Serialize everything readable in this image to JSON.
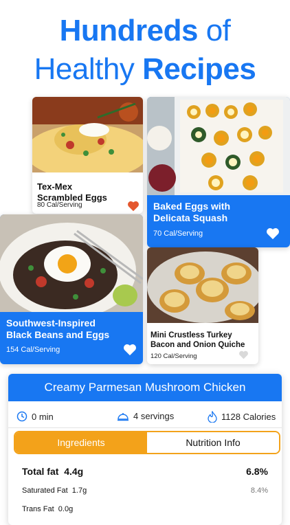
{
  "headline": {
    "line1_strong": "Hundreds",
    "line1_light": " of",
    "line2_light": "Healthy ",
    "line2_strong": "Recipes"
  },
  "cards": [
    {
      "title_line1": "Tex-Mex",
      "title_line2": "Scrambled Eggs",
      "calories": "80 Cal/Serving",
      "favorited": true
    },
    {
      "title_line1": "Baked Eggs with",
      "title_line2": "Delicata Squash",
      "calories": "70 Cal/Serving",
      "favorited": false
    },
    {
      "title_line1": "Southwest-Inspired",
      "title_line2": "Black Beans and Eggs",
      "calories": "154 Cal/Serving",
      "favorited": false
    },
    {
      "title_line1": "Mini Crustless Turkey",
      "title_line2": "Bacon and Onion Quiche",
      "calories": "120 Cal/Serving",
      "favorited": false
    }
  ],
  "detail": {
    "title": "Creamy Parmesan Mushroom Chicken",
    "time": "0 min",
    "servings": "4 servings",
    "calories": "1128 Calories",
    "tabs": {
      "ingredients": "Ingredients",
      "nutrition": "Nutrition Info"
    },
    "nutrition": [
      {
        "label": "Total fat",
        "value": "4.4g",
        "percent": "6.8%"
      },
      {
        "label": "Saturated Fat",
        "value": "1.7g",
        "percent": "8.4%"
      },
      {
        "label": "Trans Fat",
        "value": "0.0g",
        "percent": ""
      }
    ]
  },
  "colors": {
    "brand_blue": "#1877f2",
    "accent_orange": "#f3a21a",
    "heart_orange": "#e4572e"
  }
}
